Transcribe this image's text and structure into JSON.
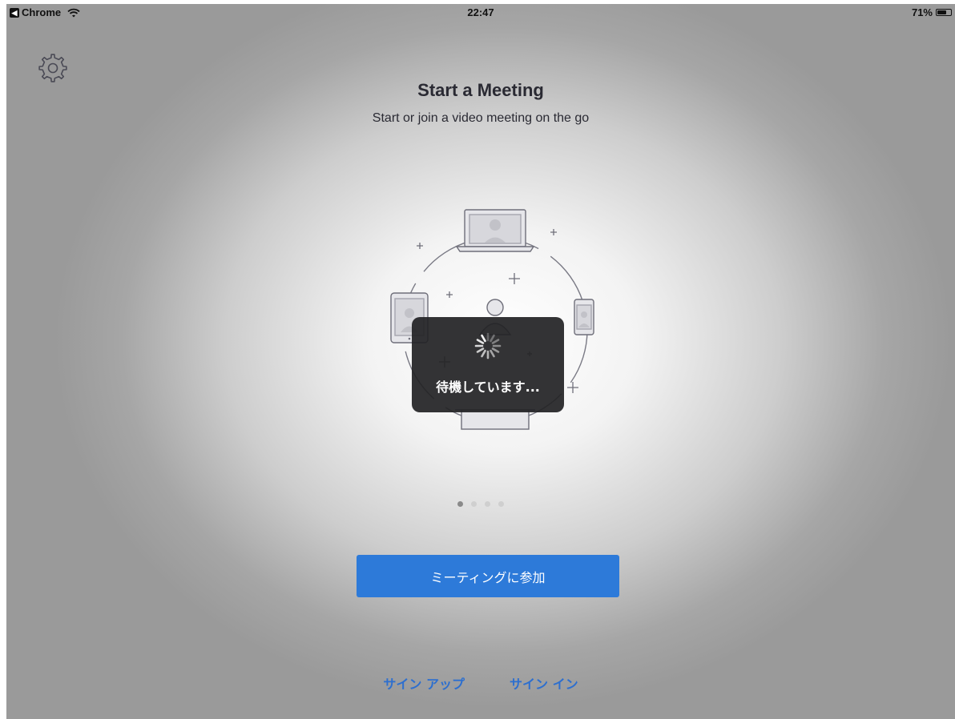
{
  "status_bar": {
    "back_app": "Chrome",
    "time": "22:47",
    "battery": "71%",
    "battery_level": 0.71
  },
  "icons": {
    "settings": "gear-icon",
    "wifi": "wifi-icon",
    "battery": "battery-icon",
    "spinner": "spinner-icon"
  },
  "main": {
    "title": "Start a Meeting",
    "subtitle": "Start or join a video meeting on the go"
  },
  "loading": {
    "text": "待機しています..."
  },
  "pager": {
    "count": 4,
    "active_index": 0
  },
  "actions": {
    "join_label": "ミーティングに参加",
    "sign_up_label": "サイン アップ",
    "sign_in_label": "サイン イン"
  },
  "colors": {
    "primary_blue": "#2d7ad9",
    "link_blue": "#2d6fcf",
    "title_text": "#2a2a33",
    "hud_bg": "#222224"
  }
}
